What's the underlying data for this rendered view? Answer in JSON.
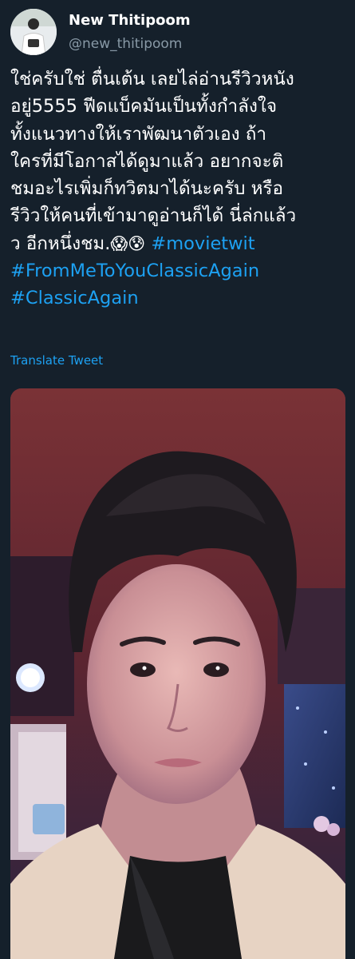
{
  "tweet": {
    "display_name": "New Thitipoom",
    "handle": "@new_thitipoom",
    "text_lines": [
      "ใช่ครับใช่ ตื่นเต้น เลยไล่อ่านรีวิวหนัง",
      "อยู่5555 ฟีดแบ็คมันเป็นทั้งกำลังใจ",
      "ทั้งแนวทางให้เราพัฒนาตัวเอง ถ้า",
      "ใครที่มีโอกาสได้ดูมาแล้ว อยากจะติ",
      "ชมอะไรเพิ่มก็ทวิตมาได้นะครับ หรือ",
      "รีวิวให้คนที่เข้ามาดูอ่านก็ได้ นี่ล่กแล้ว"
    ],
    "last_line_text": "ว อีกหนึ่งชม.",
    "emojis": [
      "😱",
      "😰"
    ],
    "hashtags": [
      "#movietwit",
      "#FromMeToYouClassicAgain",
      "#ClassicAgain"
    ],
    "translate_label": "Translate Tweet"
  },
  "colors": {
    "background": "#15202b",
    "text_primary": "#ffffff",
    "text_secondary": "#8899a6",
    "link": "#1da1f2"
  },
  "icons": {
    "avatar": "profile-photo",
    "media": "selfie-photo"
  }
}
